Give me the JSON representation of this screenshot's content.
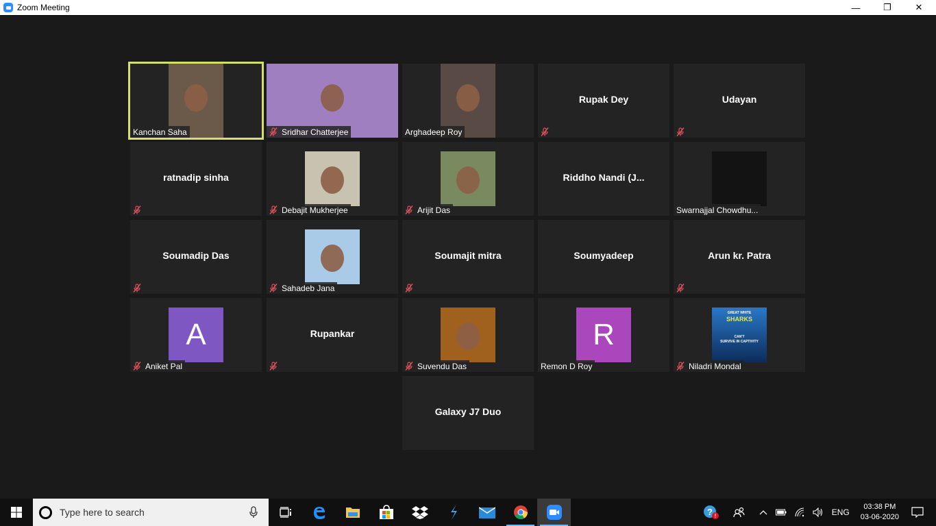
{
  "window": {
    "title": "Zoom Meeting",
    "controls": {
      "minimize": "—",
      "restore": "❐",
      "close": "✕"
    }
  },
  "colors": {
    "active_speaker_border": "#d4e06a",
    "muted_mic": "#e0525c",
    "avatar_aniket": "#7e57c2",
    "avatar_remon": "#ab47bc",
    "zoom_blue": "#2d8cff"
  },
  "participants": [
    {
      "name": "Kanchan Saha",
      "type": "video",
      "muted": false,
      "active": true,
      "video_color": "#6b5a4a"
    },
    {
      "name": "Sridhar Chatterjee",
      "type": "video-wide",
      "muted": true,
      "active": false,
      "video_color": "#a07fc0"
    },
    {
      "name": "Arghadeep Roy",
      "type": "video",
      "muted": false,
      "active": false,
      "video_color": "#5a4a45"
    },
    {
      "name": "Rupak  Dey",
      "type": "name",
      "muted": true
    },
    {
      "name": "Udayan",
      "type": "name",
      "muted": true
    },
    {
      "name": "ratnadip sinha",
      "type": "name",
      "muted": true
    },
    {
      "name": "Debajit Mukherjee",
      "type": "photo",
      "muted": true,
      "video_color": "#c8c2b0"
    },
    {
      "name": "Arijit Das",
      "type": "photo",
      "muted": true,
      "video_color": "#7a8a60"
    },
    {
      "name": "Riddho  Nandi  (J...",
      "type": "name",
      "muted": false
    },
    {
      "name": "Swarnajjal Chowdhu...",
      "type": "photo",
      "muted": false,
      "video_color": "#131313"
    },
    {
      "name": "Soumadip Das",
      "type": "name",
      "muted": true
    },
    {
      "name": "Sahadeb Jana",
      "type": "photo",
      "muted": true,
      "video_color": "#a9cbe8"
    },
    {
      "name": "Soumajit mitra",
      "type": "name",
      "muted": true
    },
    {
      "name": "Soumyadeep",
      "type": "name",
      "muted": false
    },
    {
      "name": "Arun kr. Patra",
      "type": "name",
      "muted": true
    },
    {
      "name": "Aniket Pal",
      "type": "avatar",
      "initial": "A",
      "muted": true,
      "video_color": "#7e57c2"
    },
    {
      "name": "Rupankar",
      "type": "name",
      "muted": true
    },
    {
      "name": "Suvendu Das",
      "type": "photo",
      "muted": true,
      "video_color": "#a0601e"
    },
    {
      "name": "Remon D Roy",
      "type": "avatar",
      "initial": "R",
      "muted": false,
      "video_color": "#ab47bc"
    },
    {
      "name": "Niladri Mondal",
      "type": "photo",
      "muted": true,
      "video_color": "#1d5ea8",
      "photo_text": [
        "GREAT WHITE",
        "SHARKS",
        "CAN'T",
        "SURVIVE IN CAPTIVITY"
      ]
    },
    {
      "name": "Galaxy J7 Duo",
      "type": "name",
      "muted": false
    }
  ],
  "taskbar": {
    "search_placeholder": "Type here to search",
    "apps": [
      {
        "name": "task-view",
        "icon": "task-view-icon"
      },
      {
        "name": "edge",
        "icon": "edge-icon"
      },
      {
        "name": "file-explorer",
        "icon": "folder-icon"
      },
      {
        "name": "store",
        "icon": "store-icon"
      },
      {
        "name": "dropbox",
        "icon": "dropbox-icon"
      },
      {
        "name": "app",
        "icon": "arrow-app-icon"
      },
      {
        "name": "mail",
        "icon": "mail-icon"
      },
      {
        "name": "chrome",
        "icon": "chrome-icon"
      },
      {
        "name": "zoom",
        "icon": "zoom-icon"
      }
    ],
    "tray": {
      "language": "ENG",
      "time": "03:38 PM",
      "date": "03-06-2020"
    }
  }
}
